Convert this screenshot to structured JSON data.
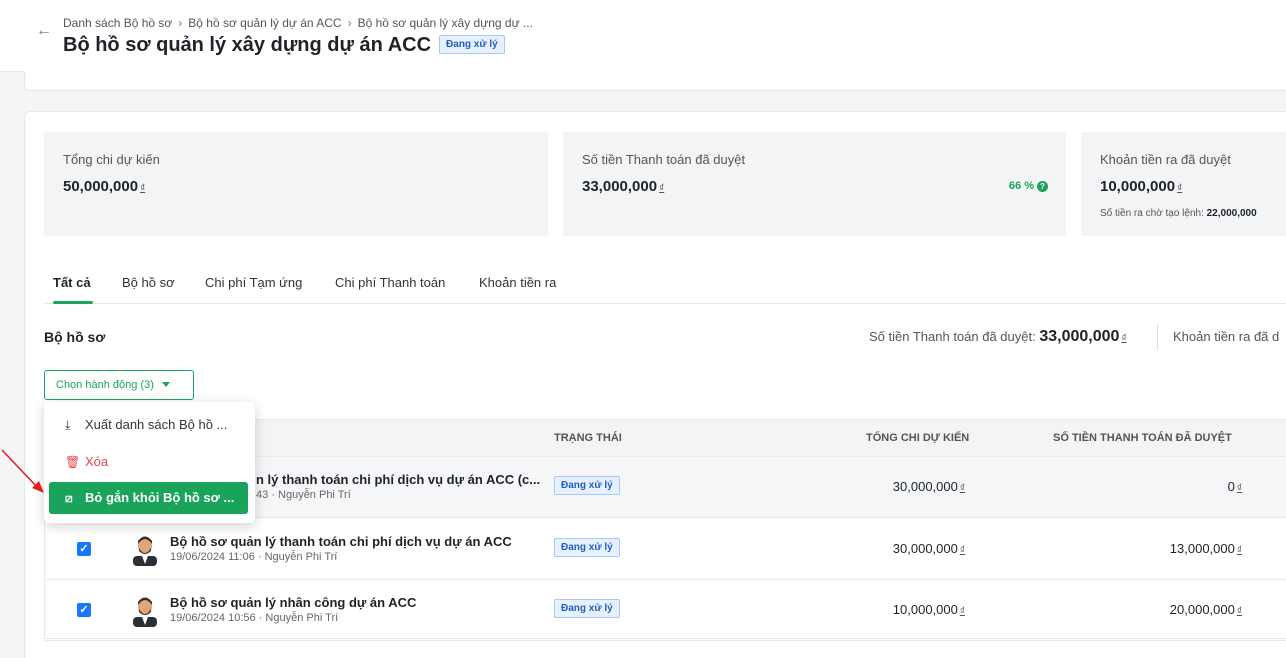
{
  "header": {
    "breadcrumbs": [
      "Danh sách Bộ hồ sơ",
      "Bộ hồ sơ quản lý dự án ACC",
      "Bộ hồ sơ quản lý xây dựng dự ..."
    ],
    "title": "Bộ hồ sơ quản lý xây dựng dự án ACC",
    "status": "Đang xử lý"
  },
  "stats": [
    {
      "label": "Tổng chi dự kiến",
      "value": "50,000,000"
    },
    {
      "label": "Số tiền Thanh toán đã duyệt",
      "value": "33,000,000",
      "percent": "66 %"
    },
    {
      "label": "Khoản tiền ra đã duyệt",
      "value": "10,000,000",
      "sub_label": "Số tiền ra chờ tạo lệnh:",
      "sub_value": "22,000,000"
    }
  ],
  "currency": "₫",
  "tabs": [
    "Tất cả",
    "Bộ hồ sơ",
    "Chi phí Tạm ứng",
    "Chi phí Thanh toán",
    "Khoản tiền ra"
  ],
  "section": {
    "title": "Bộ hồ sơ",
    "summary_label": "Số tiền Thanh toán đã duyệt:",
    "summary_value": "33,000,000",
    "summary2_label": "Khoản tiền ra đã d"
  },
  "action_button": "Chọn hành động (3)",
  "menu": {
    "export": "Xuất danh sách Bộ hồ ...",
    "delete": "Xóa",
    "unlink": "Bỏ gắn khỏi Bộ hồ sơ ..."
  },
  "table": {
    "headers": [
      "TRẠNG THÁI",
      "TỔNG CHI DỰ KIẾN",
      "SỐ TIỀN THANH TOÁN ĐÃ DUYỆT"
    ],
    "rows": [
      {
        "title": "n lý thanh toán chi phí dịch vụ dự án ACC (c...",
        "meta": "43 · Nguyễn Phi Trí",
        "status": "Đang xử lý",
        "total": "30,000,000",
        "paid": "0"
      },
      {
        "title": "Bộ hồ sơ quản lý thanh toán chi phí dịch vụ dự án ACC",
        "meta": "19/06/2024 11:06 · Nguyễn Phi Trí",
        "status": "Đang xử lý",
        "total": "30,000,000",
        "paid": "13,000,000"
      },
      {
        "title": "Bộ hồ sơ quản lý nhân công dự án ACC",
        "meta": "19/06/2024 10:56 · Nguyễn Phi Trí",
        "status": "Đang xử lý",
        "total": "10,000,000",
        "paid": "20,000,000"
      }
    ]
  },
  "colors": {
    "accent": "#1aa35b",
    "status_bg": "#e6f0ff",
    "status_text": "#1f5fbf",
    "danger": "#e5484d",
    "checkbox": "#1677ff",
    "annotation_arrow": "#e02020"
  },
  "icons": {
    "back": "arrow-left-icon",
    "export": "download-icon",
    "delete": "trash-icon",
    "unlink": "unlink-icon",
    "help": "question-circle-icon"
  }
}
